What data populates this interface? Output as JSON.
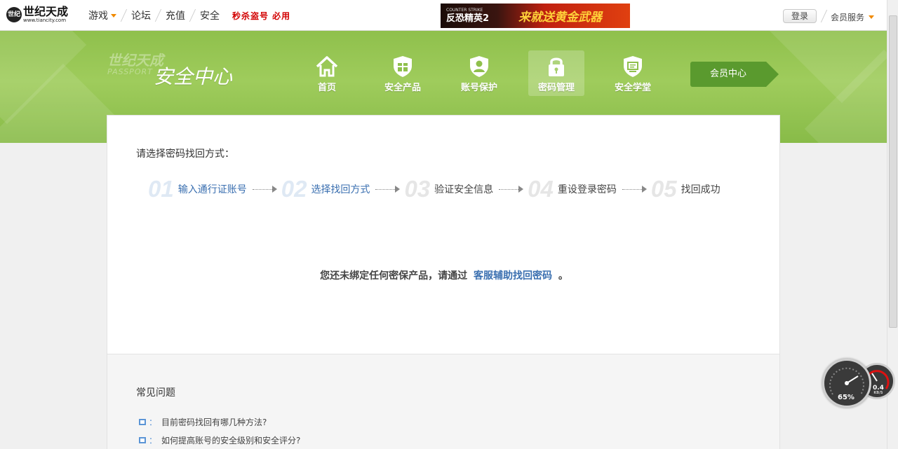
{
  "topbar": {
    "logo_cn": "世纪天成",
    "logo_url": "www.tiancity.com",
    "logo_badge": "世纪",
    "nav": [
      "游戏",
      "论坛",
      "充值",
      "安全"
    ],
    "promo": "秒杀盗号  必用",
    "banner_left_small": "COUNTER STRIKE",
    "banner_left": "反恐精英2",
    "banner_right": "来就送黄金武器",
    "login": "登录",
    "member_service": "会员服务"
  },
  "header": {
    "brand_faded": "世纪天成",
    "brand_passport": "PASSPORT",
    "brand_main": "安全中心",
    "nav": [
      {
        "label": "首页",
        "icon": "home-icon"
      },
      {
        "label": "安全产品",
        "icon": "gift-shield-icon"
      },
      {
        "label": "账号保护",
        "icon": "user-shield-icon"
      },
      {
        "label": "密码管理",
        "icon": "lock-icon",
        "active": true
      },
      {
        "label": "安全学堂",
        "icon": "classroom-shield-icon"
      }
    ],
    "member_center": "会员中心"
  },
  "main": {
    "choose_label": "请选择密码找回方式：",
    "steps": [
      {
        "num": "01",
        "label": "输入通行证账号",
        "done": true
      },
      {
        "num": "02",
        "label": "选择找回方式",
        "done": true
      },
      {
        "num": "03",
        "label": "验证安全信息",
        "done": false
      },
      {
        "num": "04",
        "label": "重设登录密码",
        "done": false
      },
      {
        "num": "05",
        "label": "找回成功",
        "done": false
      }
    ],
    "notice_prefix": "您还未绑定任何密保产品，请通过",
    "notice_link": "客服辅助找回密码",
    "notice_suffix": "。"
  },
  "faq": {
    "title": "常见问题",
    "colon": "：",
    "items": [
      "目前密码找回有哪几种方法?",
      "如何提高账号的安全级别和安全评分?"
    ]
  },
  "widget": {
    "cpu_percent": "65%",
    "speed_value": "0.4",
    "speed_unit": "KB/S"
  },
  "colors": {
    "green": "#9fcc5c",
    "link_blue": "#3a6fb0",
    "promo_red": "#d20000",
    "accent_orange": "#f08a00"
  }
}
